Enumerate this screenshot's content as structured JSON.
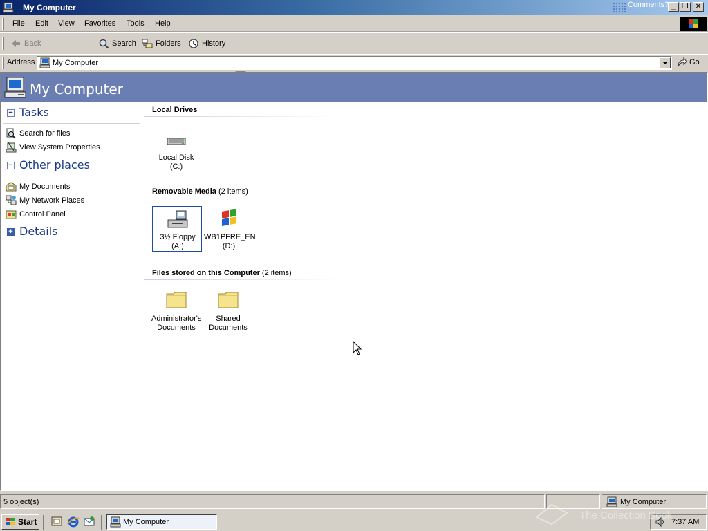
{
  "window": {
    "title": "My Computer",
    "comments_link": "Comments?",
    "minimize": "_",
    "restore": "❐",
    "close": "✕"
  },
  "menu": [
    "File",
    "Edit",
    "View",
    "Favorites",
    "Tools",
    "Help"
  ],
  "toolbar": {
    "back": "Back",
    "search": "Search",
    "folders": "Folders",
    "history": "History"
  },
  "address": {
    "label": "Address",
    "value": "My Computer",
    "go": "Go"
  },
  "banner": {
    "title": "My Computer"
  },
  "tasks": {
    "sections": [
      {
        "title": "Tasks",
        "state": "expanded"
      },
      {
        "title": "Other places",
        "state": "expanded"
      },
      {
        "title": "Details",
        "state": "collapsed"
      }
    ],
    "task_links": [
      "Search for files",
      "View System Properties"
    ],
    "place_links": [
      "My Documents",
      "My Network Places",
      "Control Panel"
    ]
  },
  "groups": [
    {
      "title": "Local Drives",
      "count": ""
    },
    {
      "title": "Removable Media",
      "count": "(2 items)"
    },
    {
      "title": "Files stored on this Computer",
      "count": "(2 items)"
    }
  ],
  "items": {
    "local_disk": {
      "line1": "Local Disk (C:)",
      "line2": ""
    },
    "floppy": {
      "line1": "3½ Floppy",
      "line2": "(A:)"
    },
    "cdrom": {
      "line1": "WB1PFRE_EN",
      "line2": "(D:)"
    },
    "admin_docs": {
      "line1": "Administrator's",
      "line2": "Documents"
    },
    "shared_docs": {
      "line1": "Shared",
      "line2": "Documents"
    }
  },
  "status": {
    "objects": "5 object(s)",
    "zone": "My Computer"
  },
  "taskbar": {
    "start": "Start",
    "active_window": "My Computer",
    "clock": "7:37 AM"
  },
  "watermark": "The Collection Book",
  "colors": {
    "titlebar_start": "#0a246a",
    "banner": "#6b7eb3",
    "task_heading": "#1d3a8a",
    "selection_border": "#1c4ea0"
  }
}
